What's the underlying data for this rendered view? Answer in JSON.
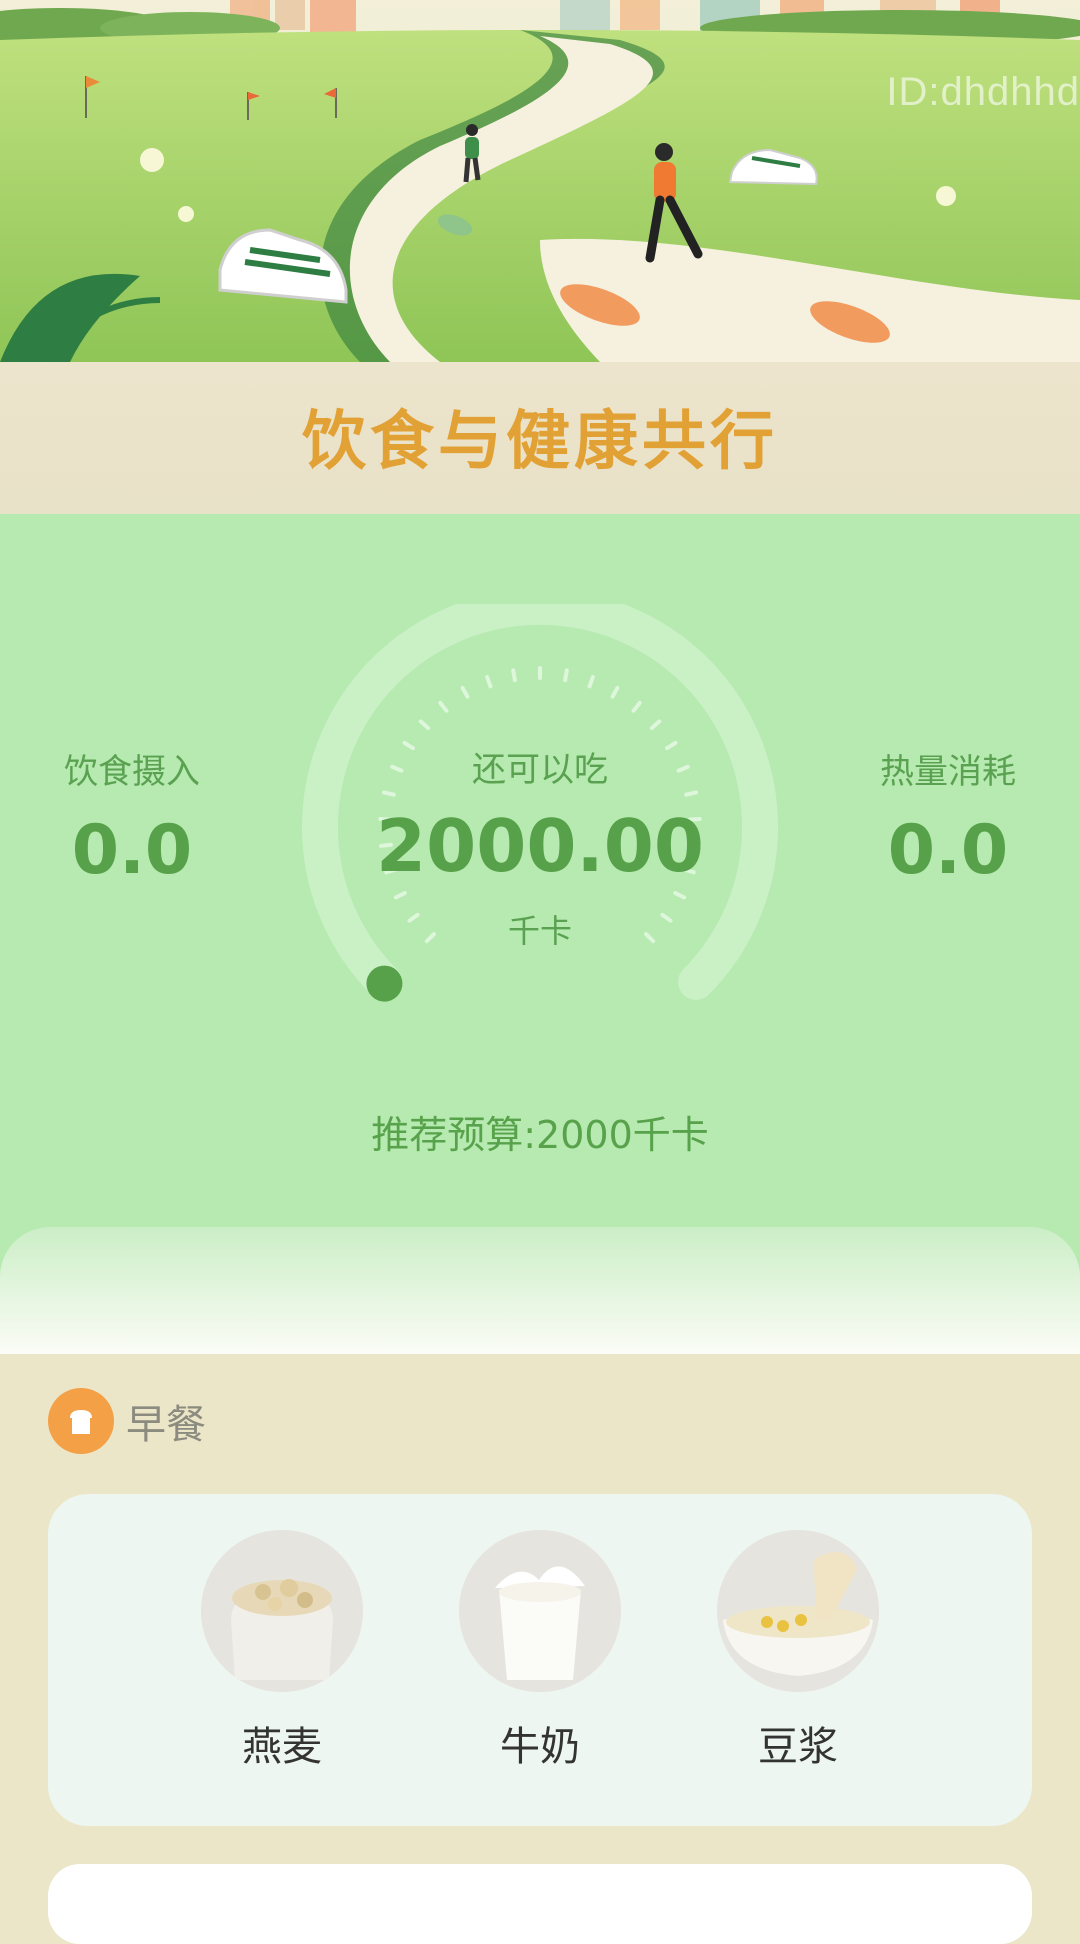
{
  "header": {
    "watermark": "ID:dhdhhd",
    "title": "饮食与健康共行"
  },
  "stats": {
    "intake_label": "饮食摄入",
    "intake_value": "0.0",
    "remaining_label": "还可以吃",
    "remaining_value": "2000.00",
    "remaining_unit": "千卡",
    "burned_label": "热量消耗",
    "burned_value": "0.0",
    "budget_text": "推荐预算:2000千卡",
    "gauge_progress": 0
  },
  "colors": {
    "accent": "#57a14a",
    "title": "#e2a134",
    "stats_bg": "#b6eab0",
    "page_bg": "#ece6c8"
  },
  "breakfast": {
    "title": "早餐",
    "icon": "bread-icon",
    "items": [
      {
        "name": "燕麦",
        "icon": "oats-image"
      },
      {
        "name": "牛奶",
        "icon": "milk-image"
      },
      {
        "name": "豆浆",
        "icon": "soymilk-image"
      }
    ]
  }
}
